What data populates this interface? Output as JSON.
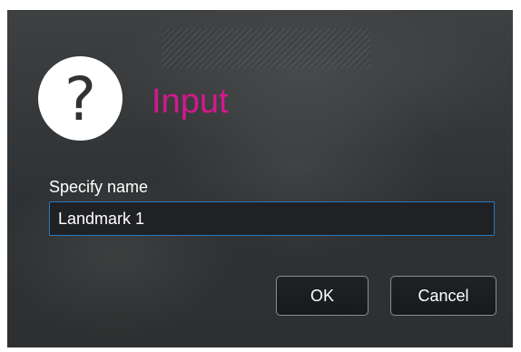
{
  "dialog": {
    "icon": "question-icon",
    "icon_glyph": "?",
    "title": "Input",
    "field_label": "Specify name",
    "input_value": "Landmark 1",
    "buttons": {
      "ok": "OK",
      "cancel": "Cancel"
    },
    "colors": {
      "title": "#d3188d",
      "input_border": "#2d78b8",
      "text": "#ffffff",
      "button_border": "#8b8e91"
    }
  }
}
